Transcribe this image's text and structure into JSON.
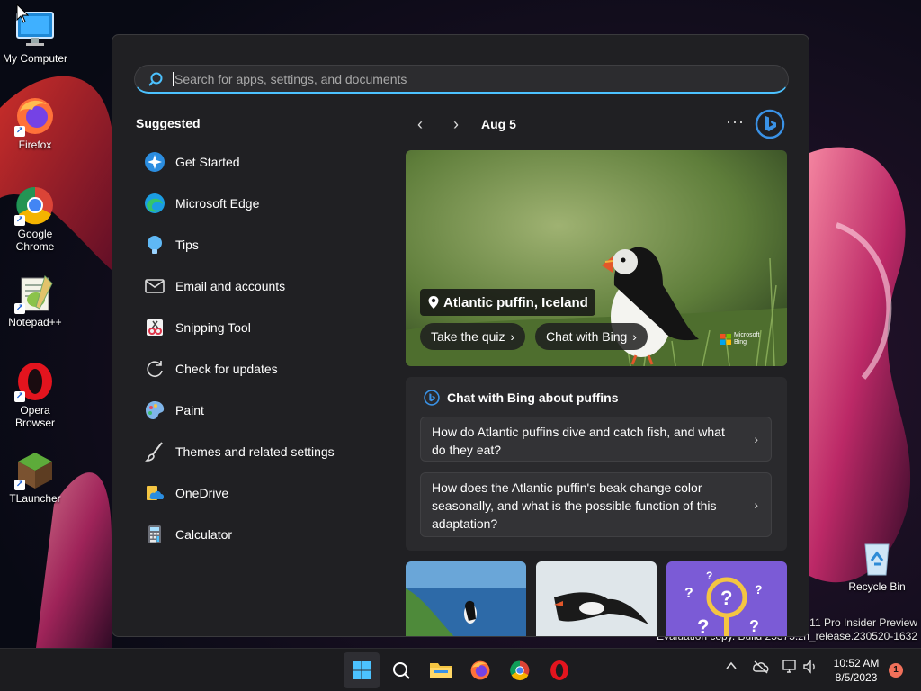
{
  "desktop": {
    "icons": [
      {
        "label": "My Computer",
        "icon": "computer-icon"
      },
      {
        "label": "Firefox",
        "icon": "firefox-icon"
      },
      {
        "label": "Google\nChrome",
        "icon": "chrome-icon"
      },
      {
        "label": "Notepad++",
        "icon": "notepadpp-icon"
      },
      {
        "label": "Opera\nBrowser",
        "icon": "opera-icon"
      },
      {
        "label": "TLauncher",
        "icon": "tlauncher-icon"
      }
    ],
    "recycle_bin": {
      "label": "Recycle Bin",
      "icon": "recycle-bin-icon"
    },
    "watermark": {
      "line1": "s 11 Pro Insider Preview",
      "line2": "Evaluation copy. Build 25375.zn_release.230520-1632"
    }
  },
  "start_menu": {
    "search": {
      "placeholder": "Search for apps, settings, and documents"
    },
    "suggested": {
      "title": "Suggested",
      "items": [
        {
          "label": "Get Started",
          "icon": "get-started-icon"
        },
        {
          "label": "Microsoft Edge",
          "icon": "edge-icon"
        },
        {
          "label": "Tips",
          "icon": "tips-icon"
        },
        {
          "label": "Email and accounts",
          "icon": "mail-icon"
        },
        {
          "label": "Snipping Tool",
          "icon": "snipping-tool-icon"
        },
        {
          "label": "Check for updates",
          "icon": "refresh-icon"
        },
        {
          "label": "Paint",
          "icon": "paint-icon"
        },
        {
          "label": "Themes and related settings",
          "icon": "brush-icon"
        },
        {
          "label": "OneDrive",
          "icon": "onedrive-icon"
        },
        {
          "label": "Calculator",
          "icon": "calculator-icon"
        }
      ]
    },
    "widget": {
      "date": "Aug 5",
      "more": "···",
      "hero": {
        "title": "Atlantic puffin, Iceland",
        "quiz_label": "Take the quiz",
        "chat_label": "Chat with Bing",
        "brand": "Microsoft Bing"
      },
      "chat": {
        "title": "Chat with Bing about puffins",
        "questions": [
          "How do Atlantic puffins dive and catch fish, and what do they eat?",
          "How does the Atlantic puffin's beak change color seasonally, and what is the possible function of this adaptation?"
        ]
      }
    }
  },
  "taskbar": {
    "clock_time": "10:52 AM",
    "clock_date": "8/5/2023",
    "notification_count": "1"
  },
  "colors": {
    "accent": "#4cc2ff",
    "menu_bg": "#202023",
    "taskbar_bg": "#1c1c1f"
  }
}
